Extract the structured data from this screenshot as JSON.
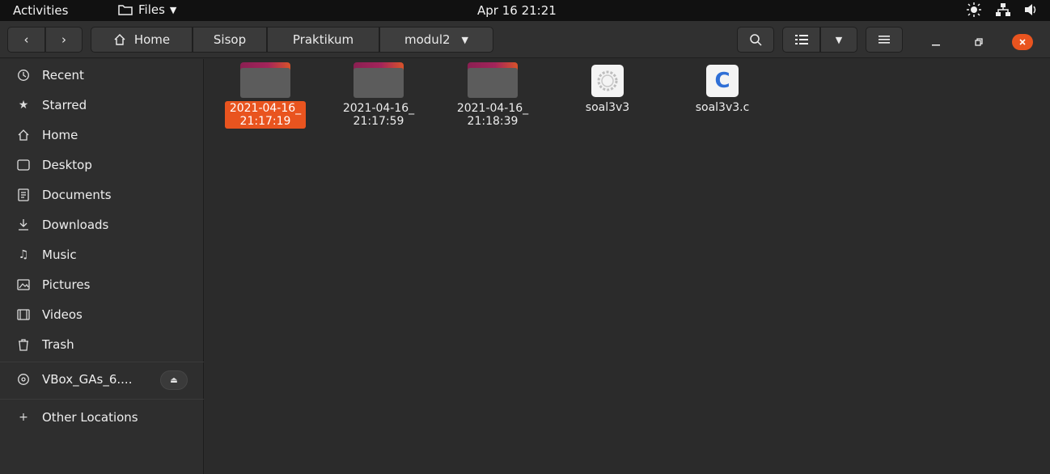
{
  "topbar": {
    "activities": "Activities",
    "app_menu": "Files",
    "clock": "Apr 16  21:21"
  },
  "header": {
    "breadcrumbs": [
      "Home",
      "Sisop",
      "Praktikum",
      "modul2"
    ]
  },
  "sidebar": {
    "items": [
      {
        "label": "Recent",
        "icon": "clock-icon"
      },
      {
        "label": "Starred",
        "icon": "star-icon"
      },
      {
        "label": "Home",
        "icon": "home-icon"
      },
      {
        "label": "Desktop",
        "icon": "desktop-icon"
      },
      {
        "label": "Documents",
        "icon": "document-icon"
      },
      {
        "label": "Downloads",
        "icon": "download-icon"
      },
      {
        "label": "Music",
        "icon": "music-icon"
      },
      {
        "label": "Pictures",
        "icon": "picture-icon"
      },
      {
        "label": "Videos",
        "icon": "video-icon"
      },
      {
        "label": "Trash",
        "icon": "trash-icon"
      }
    ],
    "device": {
      "label": "VBox_GAs_6....",
      "icon": "disc-icon"
    },
    "other_locations": "Other Locations"
  },
  "files": [
    {
      "line1": "2021-04-16_",
      "line2": "21:17:19",
      "type": "folder",
      "selected": true
    },
    {
      "line1": "2021-04-16_",
      "line2": "21:17:59",
      "type": "folder",
      "selected": false
    },
    {
      "line1": "2021-04-16_",
      "line2": "21:18:39",
      "type": "folder",
      "selected": false
    },
    {
      "line1": "soal3v3",
      "line2": "",
      "type": "executable",
      "selected": false
    },
    {
      "line1": "soal3v3.c",
      "line2": "",
      "type": "c-source",
      "selected": false
    }
  ],
  "colors": {
    "accent": "#e9541f",
    "folder_tab": "#a3245a",
    "folder_body": "#5c5c5c"
  }
}
